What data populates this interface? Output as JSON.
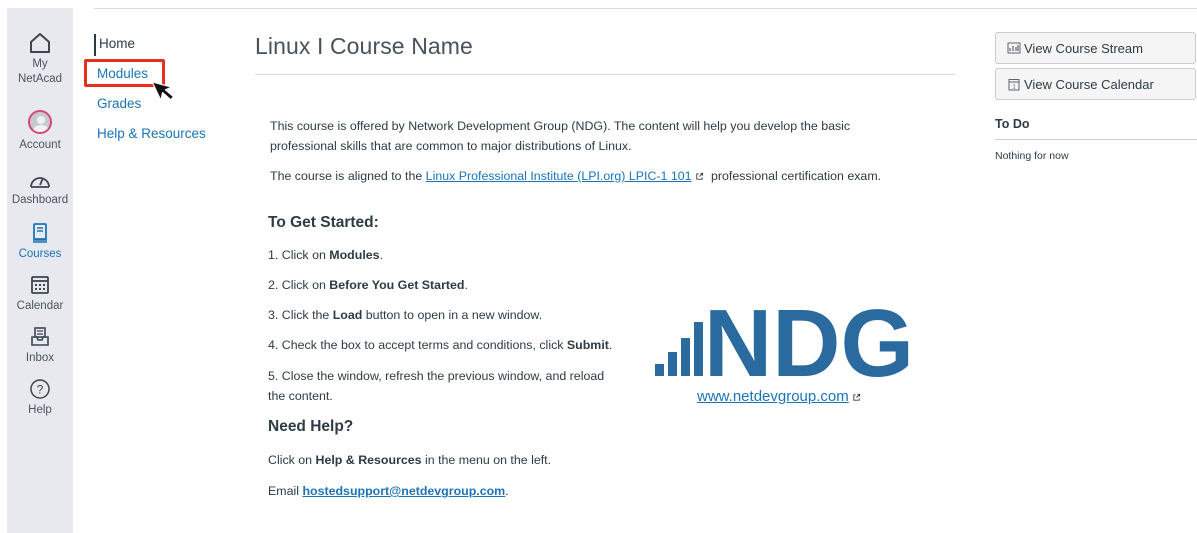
{
  "global_nav": {
    "home_label": "My\nNetAcad",
    "home_line1": "My",
    "home_line2": "NetAcad",
    "account": "Account",
    "dashboard": "Dashboard",
    "courses": "Courses",
    "calendar": "Calendar",
    "inbox": "Inbox",
    "help": "Help",
    "active_item": "Courses",
    "accent_color": "#1b74b8"
  },
  "course_nav": {
    "items": [
      {
        "label": "Home"
      },
      {
        "label": "Modules"
      },
      {
        "label": "Grades"
      },
      {
        "label": "Help & Resources"
      }
    ],
    "active_item": "Home",
    "highlight_color": "#e8311d"
  },
  "main": {
    "title": "Linux I Course Name",
    "intro": "This course is offered by Network Development Group (NDG).  The content will help you develop the basic professional skills that are common to major distributions of Linux.",
    "aligned_prefix": "The course is aligned to the ",
    "aligned_link": "Linux Professional Institute (LPI.org) LPIC-1 101",
    "aligned_suffix": " professional certification exam.",
    "get_started_heading": "To Get Started:",
    "steps": [
      {
        "pre": "1. Click on ",
        "bold": "Modules",
        "post": "."
      },
      {
        "pre": "2. Click on ",
        "bold": "Before You Get Started",
        "post": "."
      },
      {
        "pre": "3. Click the ",
        "bold": "Load",
        "post": " button to open in a new window."
      },
      {
        "pre": "4. Check the box to accept terms and conditions, click ",
        "bold": "Submit",
        "post": "."
      },
      {
        "pre": "5. Close the window, refresh the previous window, and reload",
        "bold": "",
        "post": ""
      },
      {
        "pre": "the content.",
        "bold": "",
        "post": ""
      }
    ],
    "need_help_heading": "Need Help?",
    "help_pre": "Click on ",
    "help_bold": "Help & Resources",
    "help_post": " in the menu on the left.",
    "email_pre": "Email ",
    "email_link": "hostedsupport@netdevgroup.com",
    "email_post": ".",
    "logo_text": "NDG",
    "logo_link": "www.netdevgroup.com",
    "logo_color": "#2a6a9e"
  },
  "right_sidebar": {
    "stream_button": "View Course Stream",
    "calendar_button": "View Course Calendar",
    "todo_heading": "To Do",
    "todo_empty": "Nothing for now"
  }
}
